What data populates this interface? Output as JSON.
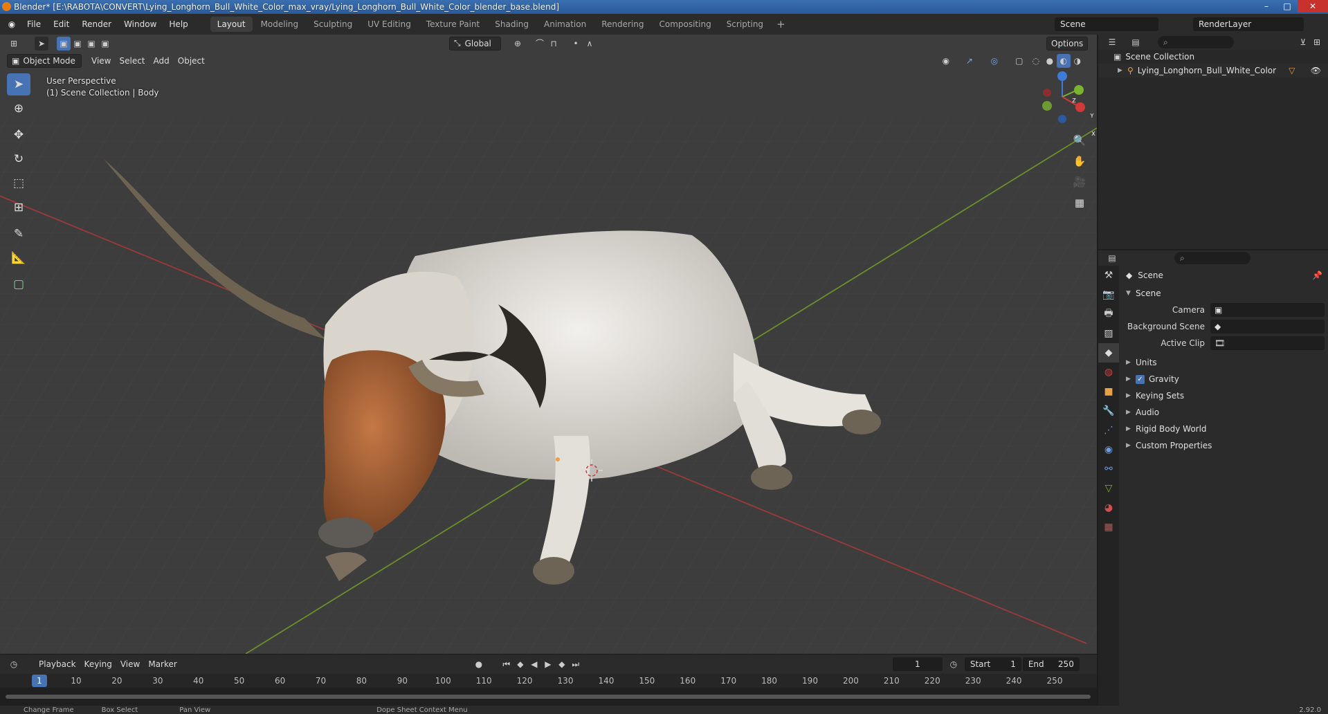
{
  "window": {
    "title": "Blender* [E:\\RABOTA\\CONVERT\\Lying_Longhorn_Bull_White_Color_max_vray/Lying_Longhorn_Bull_White_Color_blender_base.blend]"
  },
  "menu": [
    "File",
    "Edit",
    "Render",
    "Window",
    "Help"
  ],
  "workspaces": [
    "Layout",
    "Modeling",
    "Sculpting",
    "UV Editing",
    "Texture Paint",
    "Shading",
    "Animation",
    "Rendering",
    "Compositing",
    "Scripting"
  ],
  "scene_selector": {
    "scene": "Scene",
    "view_layer": "RenderLayer"
  },
  "viewport": {
    "mode": "Object Mode",
    "menus": [
      "View",
      "Select",
      "Add",
      "Object"
    ],
    "transform_orientation": "Global",
    "options_label": "Options",
    "overlay_line1": "User Perspective",
    "overlay_line2": "(1) Scene Collection | Body",
    "gizmo_axes": [
      "Z",
      "Y",
      "X"
    ]
  },
  "timeline": {
    "menus": [
      "Playback",
      "Keying",
      "View",
      "Marker"
    ],
    "current_frame": "1",
    "start_label": "Start",
    "start": "1",
    "end_label": "End",
    "end": "250",
    "ticks": [
      "1",
      "10",
      "20",
      "30",
      "40",
      "50",
      "60",
      "70",
      "80",
      "90",
      "100",
      "110",
      "120",
      "130",
      "140",
      "150",
      "160",
      "170",
      "180",
      "190",
      "200",
      "210",
      "220",
      "230",
      "240",
      "250"
    ]
  },
  "status": {
    "items": [
      "Change Frame",
      "Box Select",
      "Pan View",
      "Dope Sheet Context Menu"
    ],
    "version": "2.92.0"
  },
  "outliner": {
    "root": "Scene Collection",
    "items": [
      "Lying_Longhorn_Bull_White_Color"
    ]
  },
  "properties": {
    "context": "Scene",
    "section": "Scene",
    "fields": [
      {
        "label": "Camera",
        "value": ""
      },
      {
        "label": "Background Scene",
        "value": ""
      },
      {
        "label": "Active Clip",
        "value": ""
      }
    ],
    "panels": [
      {
        "label": "Units",
        "checkbox": false
      },
      {
        "label": "Gravity",
        "checkbox": true
      },
      {
        "label": "Keying Sets",
        "checkbox": false
      },
      {
        "label": "Audio",
        "checkbox": false
      },
      {
        "label": "Rigid Body World",
        "checkbox": false
      },
      {
        "label": "Custom Properties",
        "checkbox": false
      }
    ]
  },
  "colors": {
    "accent": "#4772b3",
    "axis_x": "#c0392b",
    "axis_y": "#7ab32e",
    "bull_body": "#e9e6e0",
    "bull_head": "#b86a38"
  }
}
